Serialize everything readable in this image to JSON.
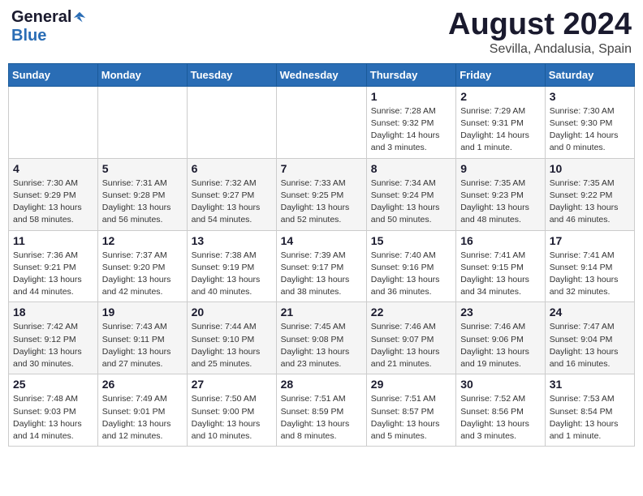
{
  "header": {
    "logo_general": "General",
    "logo_blue": "Blue",
    "month": "August 2024",
    "location": "Sevilla, Andalusia, Spain"
  },
  "weekdays": [
    "Sunday",
    "Monday",
    "Tuesday",
    "Wednesday",
    "Thursday",
    "Friday",
    "Saturday"
  ],
  "weeks": [
    [
      {
        "day": "",
        "info": ""
      },
      {
        "day": "",
        "info": ""
      },
      {
        "day": "",
        "info": ""
      },
      {
        "day": "",
        "info": ""
      },
      {
        "day": "1",
        "info": "Sunrise: 7:28 AM\nSunset: 9:32 PM\nDaylight: 14 hours\nand 3 minutes."
      },
      {
        "day": "2",
        "info": "Sunrise: 7:29 AM\nSunset: 9:31 PM\nDaylight: 14 hours\nand 1 minute."
      },
      {
        "day": "3",
        "info": "Sunrise: 7:30 AM\nSunset: 9:30 PM\nDaylight: 14 hours\nand 0 minutes."
      }
    ],
    [
      {
        "day": "4",
        "info": "Sunrise: 7:30 AM\nSunset: 9:29 PM\nDaylight: 13 hours\nand 58 minutes."
      },
      {
        "day": "5",
        "info": "Sunrise: 7:31 AM\nSunset: 9:28 PM\nDaylight: 13 hours\nand 56 minutes."
      },
      {
        "day": "6",
        "info": "Sunrise: 7:32 AM\nSunset: 9:27 PM\nDaylight: 13 hours\nand 54 minutes."
      },
      {
        "day": "7",
        "info": "Sunrise: 7:33 AM\nSunset: 9:25 PM\nDaylight: 13 hours\nand 52 minutes."
      },
      {
        "day": "8",
        "info": "Sunrise: 7:34 AM\nSunset: 9:24 PM\nDaylight: 13 hours\nand 50 minutes."
      },
      {
        "day": "9",
        "info": "Sunrise: 7:35 AM\nSunset: 9:23 PM\nDaylight: 13 hours\nand 48 minutes."
      },
      {
        "day": "10",
        "info": "Sunrise: 7:35 AM\nSunset: 9:22 PM\nDaylight: 13 hours\nand 46 minutes."
      }
    ],
    [
      {
        "day": "11",
        "info": "Sunrise: 7:36 AM\nSunset: 9:21 PM\nDaylight: 13 hours\nand 44 minutes."
      },
      {
        "day": "12",
        "info": "Sunrise: 7:37 AM\nSunset: 9:20 PM\nDaylight: 13 hours\nand 42 minutes."
      },
      {
        "day": "13",
        "info": "Sunrise: 7:38 AM\nSunset: 9:19 PM\nDaylight: 13 hours\nand 40 minutes."
      },
      {
        "day": "14",
        "info": "Sunrise: 7:39 AM\nSunset: 9:17 PM\nDaylight: 13 hours\nand 38 minutes."
      },
      {
        "day": "15",
        "info": "Sunrise: 7:40 AM\nSunset: 9:16 PM\nDaylight: 13 hours\nand 36 minutes."
      },
      {
        "day": "16",
        "info": "Sunrise: 7:41 AM\nSunset: 9:15 PM\nDaylight: 13 hours\nand 34 minutes."
      },
      {
        "day": "17",
        "info": "Sunrise: 7:41 AM\nSunset: 9:14 PM\nDaylight: 13 hours\nand 32 minutes."
      }
    ],
    [
      {
        "day": "18",
        "info": "Sunrise: 7:42 AM\nSunset: 9:12 PM\nDaylight: 13 hours\nand 30 minutes."
      },
      {
        "day": "19",
        "info": "Sunrise: 7:43 AM\nSunset: 9:11 PM\nDaylight: 13 hours\nand 27 minutes."
      },
      {
        "day": "20",
        "info": "Sunrise: 7:44 AM\nSunset: 9:10 PM\nDaylight: 13 hours\nand 25 minutes."
      },
      {
        "day": "21",
        "info": "Sunrise: 7:45 AM\nSunset: 9:08 PM\nDaylight: 13 hours\nand 23 minutes."
      },
      {
        "day": "22",
        "info": "Sunrise: 7:46 AM\nSunset: 9:07 PM\nDaylight: 13 hours\nand 21 minutes."
      },
      {
        "day": "23",
        "info": "Sunrise: 7:46 AM\nSunset: 9:06 PM\nDaylight: 13 hours\nand 19 minutes."
      },
      {
        "day": "24",
        "info": "Sunrise: 7:47 AM\nSunset: 9:04 PM\nDaylight: 13 hours\nand 16 minutes."
      }
    ],
    [
      {
        "day": "25",
        "info": "Sunrise: 7:48 AM\nSunset: 9:03 PM\nDaylight: 13 hours\nand 14 minutes."
      },
      {
        "day": "26",
        "info": "Sunrise: 7:49 AM\nSunset: 9:01 PM\nDaylight: 13 hours\nand 12 minutes."
      },
      {
        "day": "27",
        "info": "Sunrise: 7:50 AM\nSunset: 9:00 PM\nDaylight: 13 hours\nand 10 minutes."
      },
      {
        "day": "28",
        "info": "Sunrise: 7:51 AM\nSunset: 8:59 PM\nDaylight: 13 hours\nand 8 minutes."
      },
      {
        "day": "29",
        "info": "Sunrise: 7:51 AM\nSunset: 8:57 PM\nDaylight: 13 hours\nand 5 minutes."
      },
      {
        "day": "30",
        "info": "Sunrise: 7:52 AM\nSunset: 8:56 PM\nDaylight: 13 hours\nand 3 minutes."
      },
      {
        "day": "31",
        "info": "Sunrise: 7:53 AM\nSunset: 8:54 PM\nDaylight: 13 hours\nand 1 minute."
      }
    ]
  ]
}
